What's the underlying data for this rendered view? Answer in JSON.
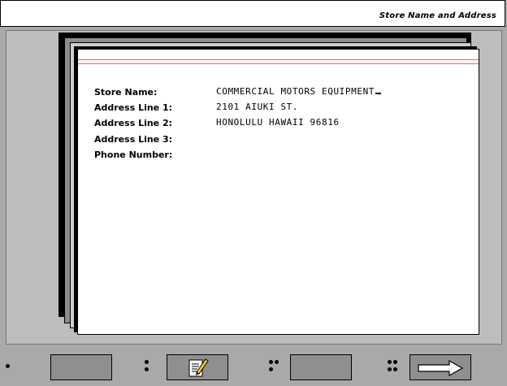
{
  "window": {
    "title": "Store Name and Address"
  },
  "form": {
    "fields": [
      {
        "label": "Store Name:",
        "value": "COMMERCIAL MOTORS EQUIPMENT"
      },
      {
        "label": "Address Line 1:",
        "value": "2101 AIUKI ST."
      },
      {
        "label": "Address Line 2:",
        "value": "HONOLULU HAWAII 96816"
      },
      {
        "label": "Address Line 3:",
        "value": ""
      },
      {
        "label": "Phone Number:",
        "value": ""
      }
    ]
  },
  "toolbar": {
    "buttons": [
      {
        "name": "dot-one-button",
        "icon": ""
      },
      {
        "name": "dot-two-button",
        "icon": "edit-document-icon"
      },
      {
        "name": "dot-three-button",
        "icon": ""
      },
      {
        "name": "dot-four-button",
        "icon": "right-arrow-icon"
      }
    ]
  },
  "colors": {
    "background": "#a9a9a9",
    "page": "#ffffff",
    "rule_line": "#e06a6a",
    "button": "#8f8f8f"
  }
}
